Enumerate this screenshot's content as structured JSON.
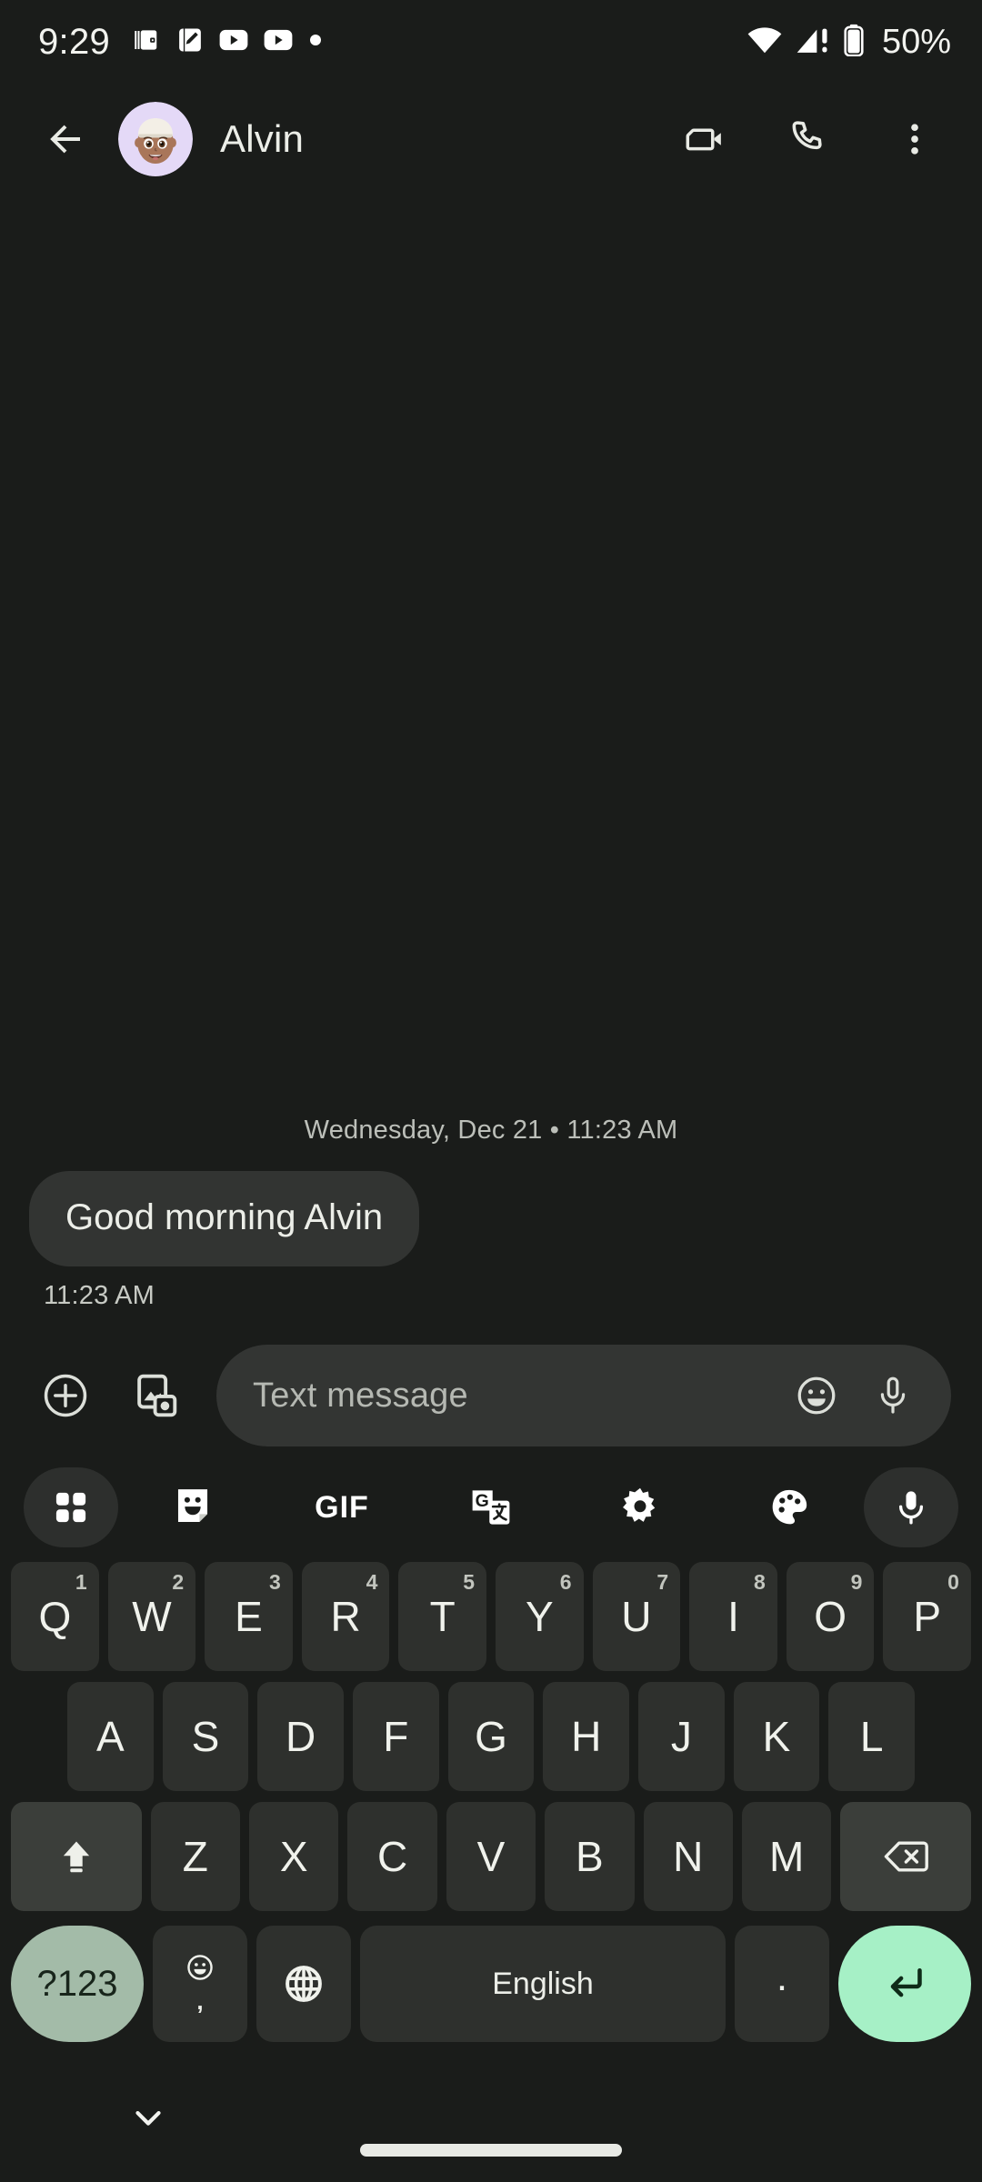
{
  "statusbar": {
    "clock": "9:29",
    "battery_text": "50%",
    "notification_icons": [
      "wallet-icon",
      "notes-pencil-icon",
      "youtube-icon",
      "youtube-icon",
      "dot-icon"
    ],
    "right_icons": [
      "wifi-icon",
      "cellular-signal-alert-icon",
      "battery-icon"
    ]
  },
  "appbar": {
    "back_label": "back-arrow",
    "contact_name": "Alvin",
    "avatar_bg": "#e4d9f7",
    "actions": [
      {
        "name": "video-call",
        "icon": "video-camera-icon"
      },
      {
        "name": "voice-call",
        "icon": "phone-icon"
      },
      {
        "name": "more-options",
        "icon": "overflow-menu-icon"
      }
    ]
  },
  "conversation": {
    "date_divider": "Wednesday, Dec 21 • 11:23 AM",
    "messages": [
      {
        "text": "Good morning Alvin",
        "time": "11:23 AM",
        "side": "incoming"
      }
    ]
  },
  "composer": {
    "attach_icon": "plus-circle-icon",
    "gallery_icon": "gallery-camera-icon",
    "placeholder": "Text message",
    "emoji_icon": "emoji-smiley-icon",
    "mic_icon": "microphone-icon"
  },
  "keyboard": {
    "toolbar": [
      {
        "name": "apps-grid-icon",
        "label": ""
      },
      {
        "name": "sticker-icon",
        "label": ""
      },
      {
        "name": "gif-icon",
        "label": "GIF"
      },
      {
        "name": "translate-icon",
        "label": ""
      },
      {
        "name": "settings-gear-icon",
        "label": ""
      },
      {
        "name": "theme-palette-icon",
        "label": ""
      },
      {
        "name": "voice-input-icon",
        "label": ""
      }
    ],
    "row1": [
      {
        "key": "Q",
        "num": "1"
      },
      {
        "key": "W",
        "num": "2"
      },
      {
        "key": "E",
        "num": "3"
      },
      {
        "key": "R",
        "num": "4"
      },
      {
        "key": "T",
        "num": "5"
      },
      {
        "key": "Y",
        "num": "6"
      },
      {
        "key": "U",
        "num": "7"
      },
      {
        "key": "I",
        "num": "8"
      },
      {
        "key": "O",
        "num": "9"
      },
      {
        "key": "P",
        "num": "0"
      }
    ],
    "row2": [
      "A",
      "S",
      "D",
      "F",
      "G",
      "H",
      "J",
      "K",
      "L"
    ],
    "row3": {
      "shift": "shift-up-arrow-icon",
      "letters": [
        "Z",
        "X",
        "C",
        "V",
        "B",
        "N",
        "M"
      ],
      "backspace": "backspace-delete-icon"
    },
    "row4": {
      "symbols": "?123",
      "comma_icon": "emoji-smiley-icon",
      "comma": ",",
      "globe": "globe-language-icon",
      "space_label": "English",
      "period": ".",
      "enter": "enter-return-icon"
    },
    "colors": {
      "key_bg": "#2e302d",
      "mod_key_bg": "#3b3e3a",
      "symbols_key_bg": "#a3bba8",
      "enter_key_bg": "#a6f0c6",
      "key_text": "#f0f2ec"
    }
  },
  "navbar": {
    "hide_keyboard_icon": "chevron-down-icon",
    "gesture_pill": "home-gesture-pill"
  }
}
